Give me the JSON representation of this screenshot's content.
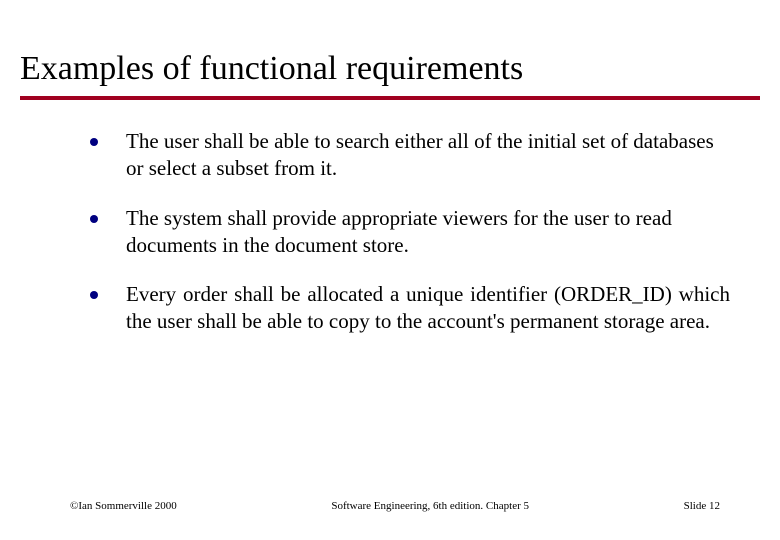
{
  "slide": {
    "title": "Examples of functional requirements",
    "bullets": [
      "The user shall be able to search either all of the initial set of databases or select a subset from it.",
      "The system shall provide appropriate viewers for the user to read documents in the document store.",
      "Every order shall be allocated a unique identifier (ORDER_ID) which the user shall be able to copy to the account's permanent storage area."
    ],
    "footer": {
      "left": "©Ian Sommerville 2000",
      "center": "Software Engineering, 6th edition. Chapter 5",
      "right": "Slide 12"
    }
  }
}
